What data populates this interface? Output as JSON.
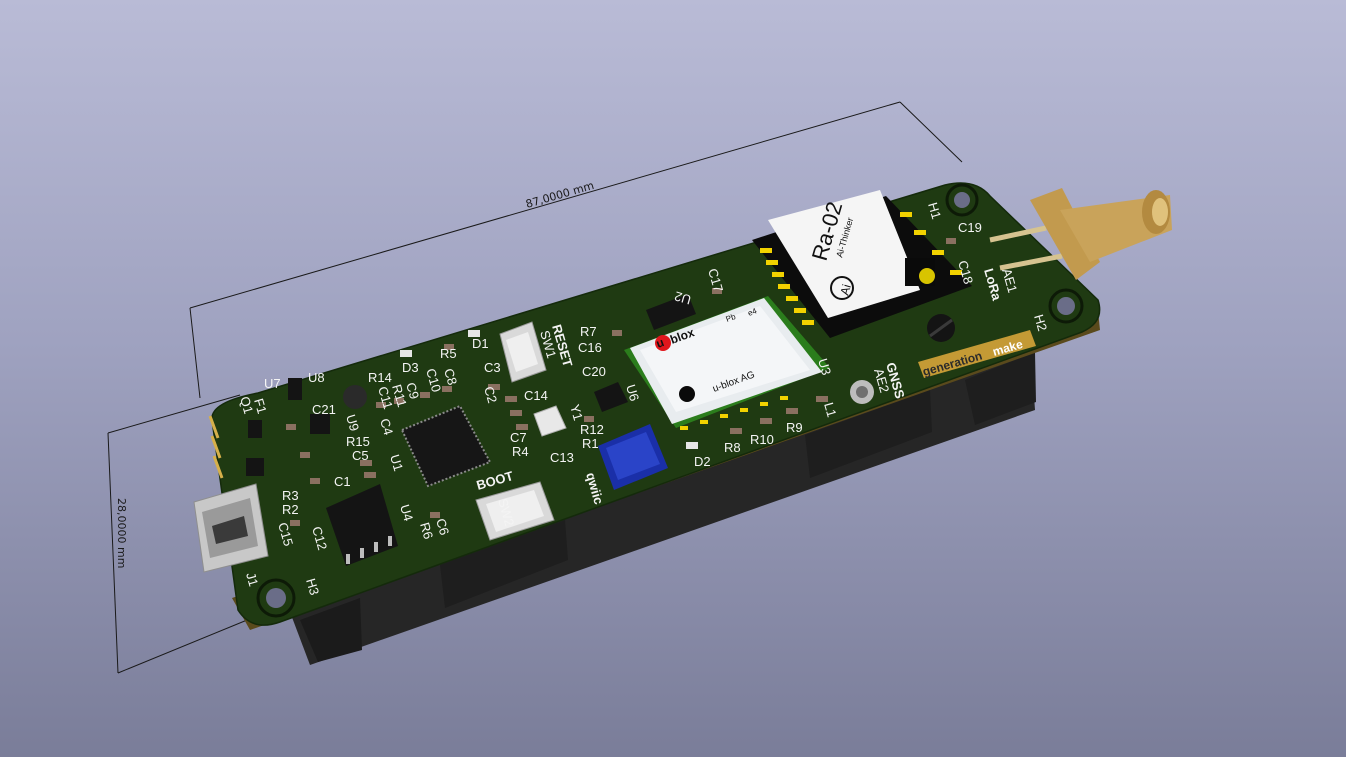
{
  "colors": {
    "background_top": "#b9bbd6",
    "background_bottom": "#7a7d99",
    "pcb": "#1f3a12",
    "silkscreen": "#f4f4f4",
    "sma": "#c9a35a",
    "jumper": "#1a2fa8"
  },
  "dimensions": {
    "length": "87,0000 mm",
    "width": "28,0000 mm"
  },
  "modules": {
    "lora_name": "Ra-02",
    "lora_vendor": "Ai-Thinker",
    "lora_logo": "Ai",
    "gnss_brand": "blox",
    "gnss_brand_u": "u",
    "gnss_vendor": "u-blox AG",
    "gnss_pb": "Pb",
    "gnss_e4": "e4",
    "branding": "generation",
    "branding2": "make"
  },
  "labels": {
    "reset": "RESET",
    "sw1": "SW1",
    "boot": "BOOT",
    "sw2": "SW2",
    "lora": "LoRa",
    "ae1": "AE1",
    "gnss": "GNSS",
    "ae2": "AE2",
    "qwiic": "qwiic",
    "u1": "U1",
    "u2": "U2",
    "u3": "U3",
    "u4": "U4",
    "u6": "U6",
    "u7": "U7",
    "u8": "U8",
    "u9": "U9",
    "j1": "J1",
    "h1": "H1",
    "h2": "H2",
    "h3": "H3",
    "y1": "Y1",
    "l1": "L1",
    "f1": "F1",
    "q1": "Q1",
    "d1": "D1",
    "d2": "D2",
    "d3": "D3",
    "r1": "R1",
    "r2": "R2",
    "r3": "R3",
    "r4": "R4",
    "r5": "R5",
    "r6": "R6",
    "r7": "R7",
    "r8": "R8",
    "r9": "R9",
    "r10": "R10",
    "r11": "R11",
    "r12": "R12",
    "r14": "R14",
    "r15": "R15",
    "c1": "C1",
    "c2": "C2",
    "c3": "C3",
    "c4": "C4",
    "c5": "C5",
    "c6": "C6",
    "c7": "C7",
    "c8": "C8",
    "c9": "C9",
    "c10": "C10",
    "c11": "C11",
    "c12": "C12",
    "c13": "C13",
    "c14": "C14",
    "c15": "C15",
    "c16": "C16",
    "c17": "C17",
    "c18": "C18",
    "c19": "C19",
    "c20": "C20",
    "c21": "C21"
  }
}
